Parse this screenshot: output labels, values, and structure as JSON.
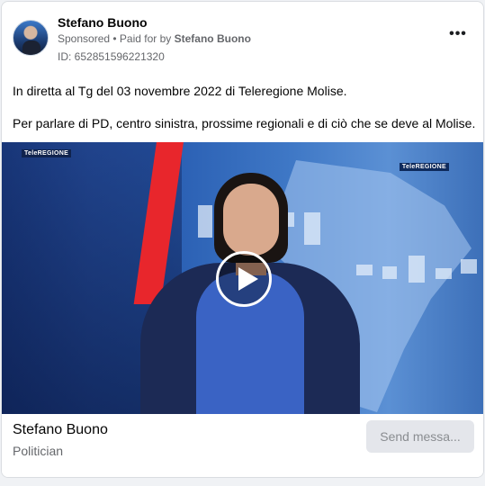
{
  "ad": {
    "advertiser_name": "Stefano Buono",
    "sponsored_label": "Sponsored",
    "separator": " • ",
    "paid_for_prefix": "Paid for by ",
    "paid_for_name": "Stefano Buono",
    "ad_id": "ID: 652851596221320",
    "more_icon_glyph": "•••"
  },
  "body": {
    "paragraphs": [
      "In diretta al Tg del 03 novembre 2022 di Teleregione Molise.",
      "Per parlare di PD, centro sinistra, prossime regionali e di ciò che se deve al Molise."
    ]
  },
  "video": {
    "logo_left": "TeleREGIONE",
    "logo_right": "TeleREGIONE",
    "play_icon": "play-icon"
  },
  "footer": {
    "page_name": "Stefano Buono",
    "page_category": "Politician",
    "cta_label": "Send messa..."
  },
  "colors": {
    "card_bg": "#ffffff",
    "secondary_text": "#65676b",
    "cta_bg": "#e4e6eb",
    "stripe_red": "#e8262c"
  }
}
